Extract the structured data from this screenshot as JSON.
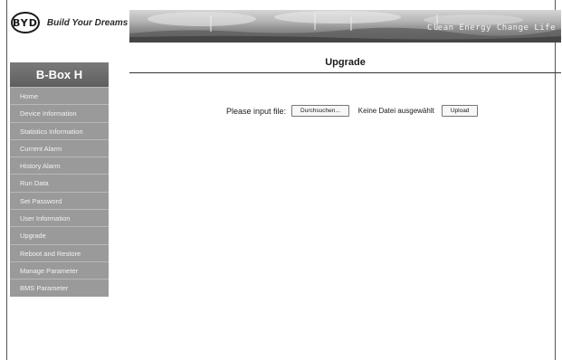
{
  "header": {
    "logo": "BYD",
    "tagline": "Build Your Dreams",
    "banner_text": "Clean Energy Change Life"
  },
  "sidebar": {
    "title": "B-Box H",
    "items": [
      {
        "label": "Home"
      },
      {
        "label": "Device Information"
      },
      {
        "label": "Statistics Information"
      },
      {
        "label": "Current Alarm"
      },
      {
        "label": "History Alarm"
      },
      {
        "label": "Run Data"
      },
      {
        "label": "Set Password"
      },
      {
        "label": "User Information"
      },
      {
        "label": "Upgrade"
      },
      {
        "label": "Reboot and Restore"
      },
      {
        "label": "Manage Parameter"
      },
      {
        "label": "BMS Parameter"
      }
    ]
  },
  "main": {
    "title": "Upgrade",
    "file_label": "Please input file:",
    "browse_button": "Durchsuchen...",
    "no_file_text": "Keine Datei ausgewählt",
    "upload_button": "Upload"
  },
  "colors": {
    "sidebar_item": "#9a9a9a",
    "sidebar_title": "#6b6b6b",
    "text": "#1a1a1a"
  }
}
